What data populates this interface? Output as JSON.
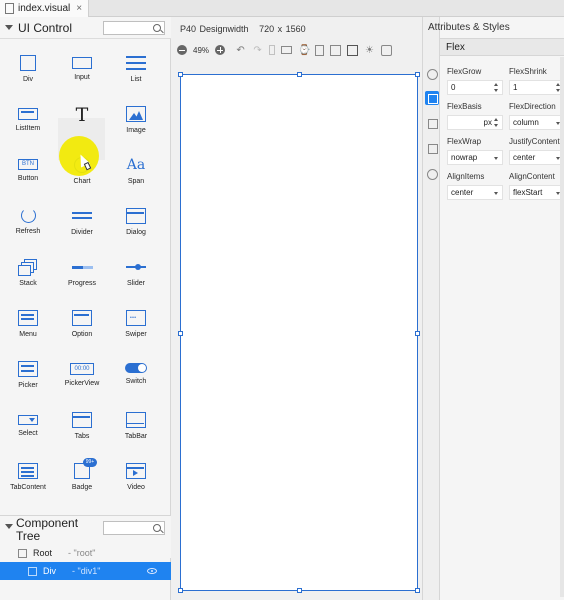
{
  "tab": {
    "title": "index.visual",
    "close": "×"
  },
  "palette": {
    "title": "UI Control",
    "widgets": [
      {
        "label": "Div"
      },
      {
        "label": "Input"
      },
      {
        "label": "List"
      },
      {
        "label": "ListItem"
      },
      {
        "label": "Text"
      },
      {
        "label": "Image"
      },
      {
        "label": "Button"
      },
      {
        "label": "Chart"
      },
      {
        "label": "Span"
      },
      {
        "label": "Refresh"
      },
      {
        "label": "Divider"
      },
      {
        "label": "Dialog"
      },
      {
        "label": "Stack"
      },
      {
        "label": "Progress"
      },
      {
        "label": "Slider"
      },
      {
        "label": "Menu"
      },
      {
        "label": "Option"
      },
      {
        "label": "Swiper"
      },
      {
        "label": "Picker"
      },
      {
        "label": "PickerView"
      },
      {
        "label": "Switch"
      },
      {
        "label": "Select"
      },
      {
        "label": "Tabs"
      },
      {
        "label": "TabBar"
      },
      {
        "label": "TabContent"
      },
      {
        "label": "Badge"
      },
      {
        "label": "Video"
      }
    ],
    "icon_text": {
      "button": "BTN",
      "span": "Aa",
      "pickerview": "00:00",
      "badge": "99+",
      "text": "T"
    }
  },
  "component_tree": {
    "title": "Component Tree",
    "rows": [
      {
        "name": "Root",
        "id": "- \"root\""
      },
      {
        "name": "Div",
        "id": "- \"div1\""
      }
    ]
  },
  "canvas": {
    "device": "P40 Designwidth",
    "resolution": "720 x 1560",
    "zoom": "49%"
  },
  "attributes": {
    "title": "Attributes & Styles",
    "section": "Flex",
    "props": [
      {
        "label": "FlexGrow",
        "value": "0",
        "control": "spin"
      },
      {
        "label": "FlexShrink",
        "value": "1",
        "control": "spin"
      },
      {
        "label": "FlexBasis",
        "value": "",
        "unit": "px",
        "control": "spin"
      },
      {
        "label": "FlexDirection",
        "value": "column",
        "control": "dropdown"
      },
      {
        "label": "FlexWrap",
        "value": "nowrap",
        "control": "dropdown"
      },
      {
        "label": "JustifyContent",
        "value": "center",
        "control": "dropdown"
      },
      {
        "label": "AlignItems",
        "value": "center",
        "control": "dropdown"
      },
      {
        "label": "AlignContent",
        "value": "flexStart",
        "control": "dropdown"
      }
    ]
  },
  "colors": {
    "accent": "#1f83f0",
    "icon": "#2b6fd1",
    "cursor_highlight": "#f2ea00"
  }
}
